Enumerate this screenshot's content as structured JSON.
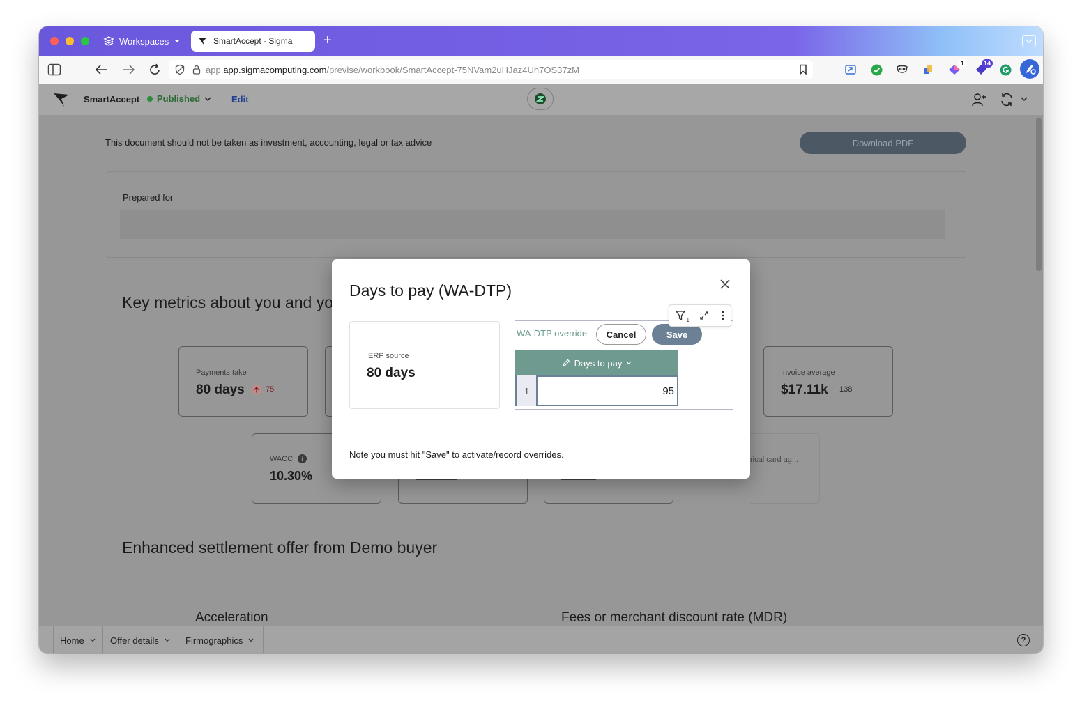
{
  "browser": {
    "workspaces_label": "Workspaces",
    "tab_title": "SmartAccept - Sigma",
    "url_host": "app.sigmacomputing.com",
    "url_path": "/previse/workbook/SmartAccept-75NVam2uHJaz4Uh7OS37zM",
    "ext_badge_1": "1",
    "ext_badge_2": "14"
  },
  "app": {
    "workbook_name": "SmartAccept",
    "status": "Published",
    "edit_label": "Edit"
  },
  "page": {
    "disclaimer": "This document should not be taken as investment, accounting, legal or tax advice",
    "download_pdf": "Download PDF",
    "prepared_for": "Prepared for",
    "key_metrics_title": "Key metrics about you and yo",
    "cards": {
      "payments_take_label": "Payments take",
      "payments_take_value": "80 days",
      "payments_take_delta": "75",
      "invoice_average_label": "Invoice average",
      "invoice_average_value": "$17.11k",
      "invoice_average_sub": "138",
      "wacc_label": "WACC",
      "wacc_value": "10.30%",
      "partial_card_label": "rical card ag..."
    },
    "settlement_title": "Enhanced settlement offer from Demo buyer",
    "acceleration_title": "Acceleration",
    "fees_title": "Fees or merchant discount rate (MDR)"
  },
  "bottom_tabs": [
    "Home",
    "Offer details",
    "Firmographics"
  ],
  "modal": {
    "title": "Days to pay (WA-DTP)",
    "erp_label": "ERP source",
    "erp_value": "80 days",
    "override_label": "WA-DTP override",
    "cancel": "Cancel",
    "save": "Save",
    "column_header": "Days to pay",
    "row_index": "1",
    "row_value": "95",
    "filter_count": "1",
    "note": "Note you must hit \"Save\" to activate/record overrides."
  },
  "colors": {
    "accent_teal": "#6a9a8f",
    "save_button": "#6c8196",
    "published_green": "#2e9a3e",
    "edit_blue": "#2d5bd1"
  }
}
